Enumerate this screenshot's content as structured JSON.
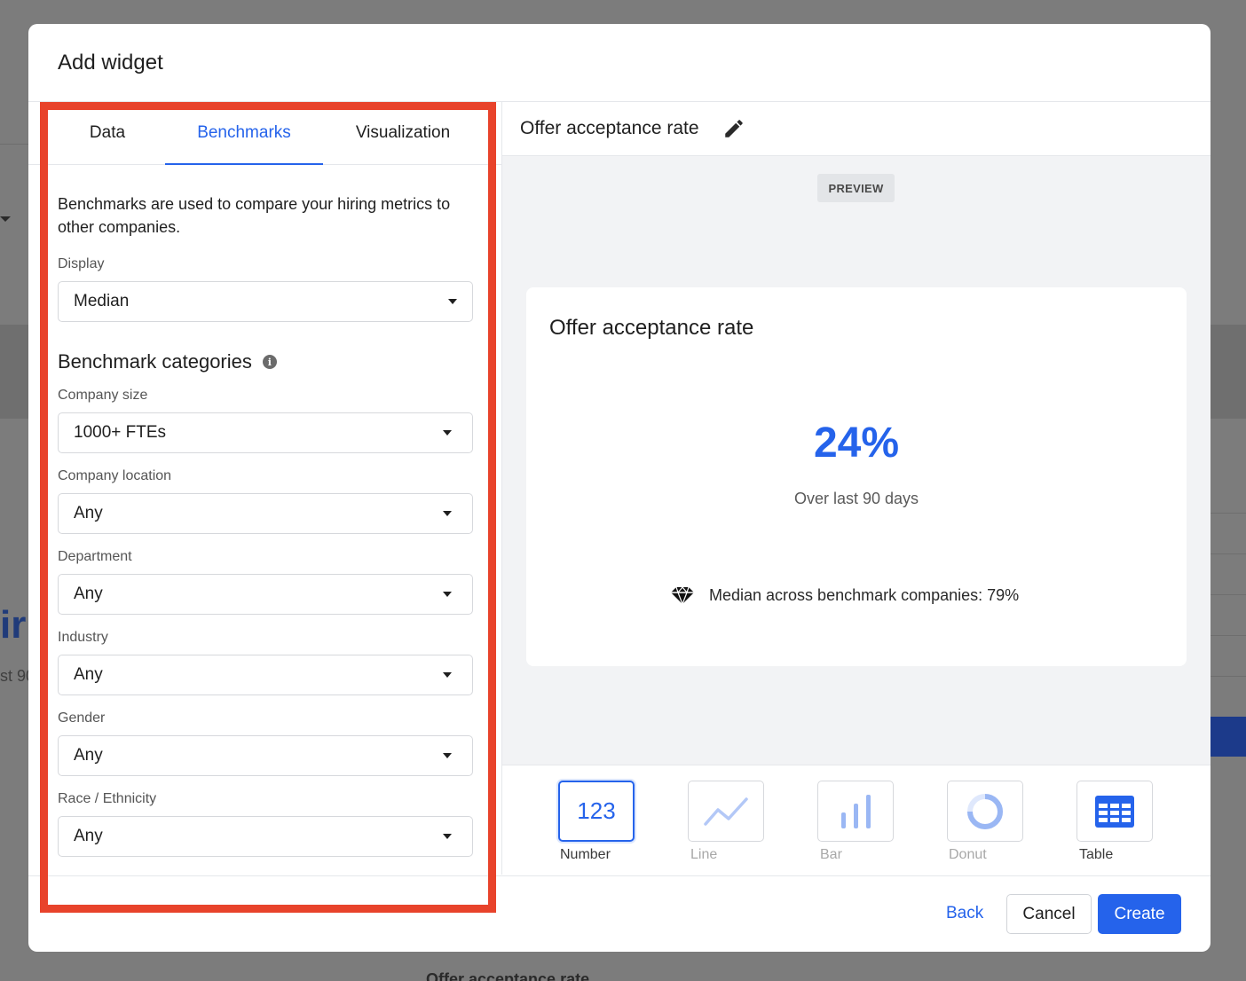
{
  "colors": {
    "accent": "#2563eb",
    "highlight": "#e8432b",
    "preview_bg": "#f2f3f5"
  },
  "background": {
    "partial_big_text": "ir",
    "partial_small_text": "st 90",
    "partial_bottom_text": "Offer acceptance rate"
  },
  "modal": {
    "title": "Add widget",
    "tabs": [
      {
        "label": "Data",
        "active": false
      },
      {
        "label": "Benchmarks",
        "active": true
      },
      {
        "label": "Visualization",
        "active": false
      }
    ],
    "benchmarks": {
      "description": "Benchmarks are used to compare your hiring metrics to other companies.",
      "display": {
        "label": "Display",
        "value": "Median"
      },
      "categories_title": "Benchmark categories",
      "categories_info_icon": "info-icon",
      "fields": [
        {
          "label": "Company size",
          "value": "1000+ FTEs"
        },
        {
          "label": "Company location",
          "value": "Any"
        },
        {
          "label": "Department",
          "value": "Any"
        },
        {
          "label": "Industry",
          "value": "Any"
        },
        {
          "label": "Gender",
          "value": "Any"
        },
        {
          "label": "Race / Ethnicity",
          "value": "Any"
        }
      ]
    },
    "right": {
      "widget_title": "Offer acceptance rate",
      "edit_icon": "pencil-icon",
      "preview_badge": "PREVIEW",
      "card": {
        "title": "Offer acceptance rate",
        "value": "24%",
        "period": "Over last 90 days",
        "benchmark_icon": "diamond-icon",
        "benchmark_text": "Median across benchmark companies: 79%"
      },
      "visualizations": [
        {
          "label": "Number",
          "icon": "number-icon",
          "glyph": "123",
          "selected": true,
          "enabled": true
        },
        {
          "label": "Line",
          "icon": "line-chart-icon",
          "selected": false,
          "enabled": false
        },
        {
          "label": "Bar",
          "icon": "bar-chart-icon",
          "selected": false,
          "enabled": false
        },
        {
          "label": "Donut",
          "icon": "donut-chart-icon",
          "selected": false,
          "enabled": false
        },
        {
          "label": "Table",
          "icon": "table-icon",
          "selected": false,
          "enabled": true
        }
      ]
    },
    "footer": {
      "back_label": "Back",
      "cancel_label": "Cancel",
      "create_label": "Create"
    }
  }
}
